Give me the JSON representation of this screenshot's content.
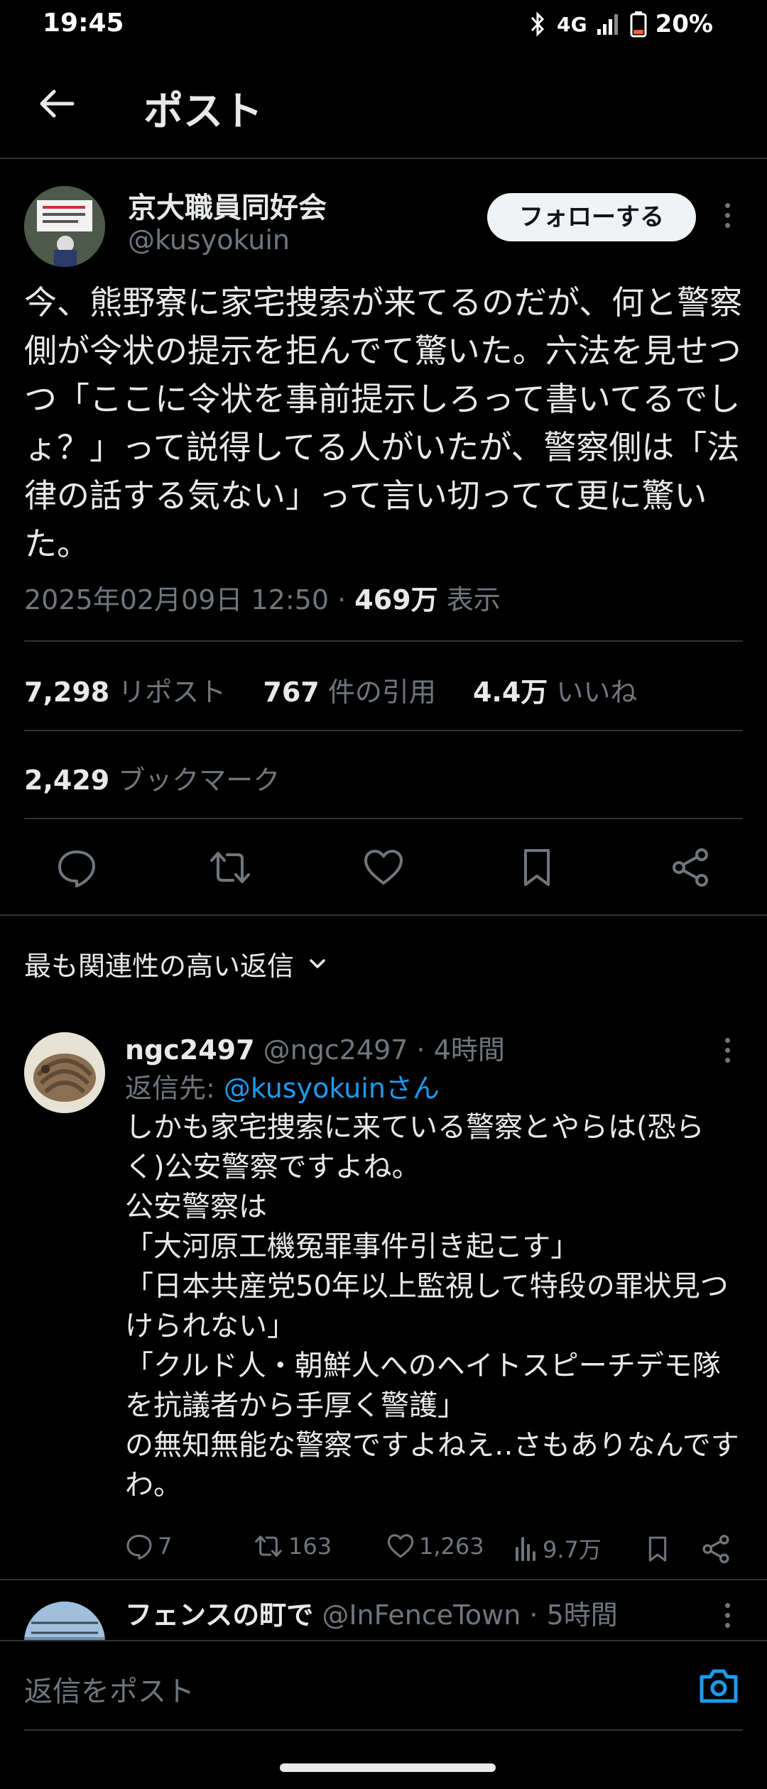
{
  "status_bar": {
    "time": "19:45",
    "network": "4G",
    "battery": "20%"
  },
  "header": {
    "title": "ポスト"
  },
  "post": {
    "author_name": "京大職員同好会",
    "author_handle": "@kusyokuin",
    "follow_label": "フォローする",
    "body": "今、熊野寮に家宅捜索が来てるのだが、何と警察側が令状の提示を拒んでて驚いた。六法を見せつつ「ここに令状を事前提示しろって書いてるでしょ？」って説得してる人がいたが、警察側は「法律の話する気ない」って言い切ってて更に驚いた。",
    "datetime": "2025年02月09日 12:50",
    "views_count": "469万",
    "views_label": "表示",
    "stats": {
      "reposts_count": "7,298",
      "reposts_label": "リポスト",
      "quotes_count": "767",
      "quotes_label": "件の引用",
      "likes_count": "4.4万",
      "likes_label": "いいね",
      "bookmarks_count": "2,429",
      "bookmarks_label": "ブックマーク"
    }
  },
  "sort_label": "最も関連性の高い返信",
  "reply": {
    "author_name": "ngc2497",
    "author_handle": "@ngc2497",
    "time": "4時間",
    "reply_to_prefix": "返信先: ",
    "reply_to_user": "@kusyokuinさん",
    "lines": [
      "しかも家宅捜索に来ている警察とやらは(恐らく)公安警察ですよね。",
      "公安警察は",
      "「大河原工機冤罪事件引き起こす」",
      "「日本共産党50年以上監視して特段の罪状見つけられない」",
      "「クルド人・朝鮮人へのヘイトスピーチデモ隊を抗議者から手厚く警護」",
      "の無知無能な警察ですよねえ‥さもありなんですわ。"
    ],
    "replies": "7",
    "reposts": "163",
    "likes": "1,263",
    "views": "9.7万"
  },
  "reply2": {
    "author_name": "フェンスの町で",
    "author_handle": "@InFenceTown",
    "time": "5時間"
  },
  "composer": {
    "placeholder": "返信をポスト"
  },
  "icons": {
    "back": "arrow-left-icon",
    "more": "more-vertical-icon",
    "reply": "comment-icon",
    "repost": "repost-icon",
    "like": "heart-icon",
    "bookmark": "bookmark-icon",
    "share": "share-icon",
    "views": "bar-chart-icon",
    "camera": "camera-icon"
  },
  "colors": {
    "background": "#000000",
    "text": "#e7e9ea",
    "muted": "#71767b",
    "link": "#1d9bf0",
    "divider": "#2f3336"
  }
}
